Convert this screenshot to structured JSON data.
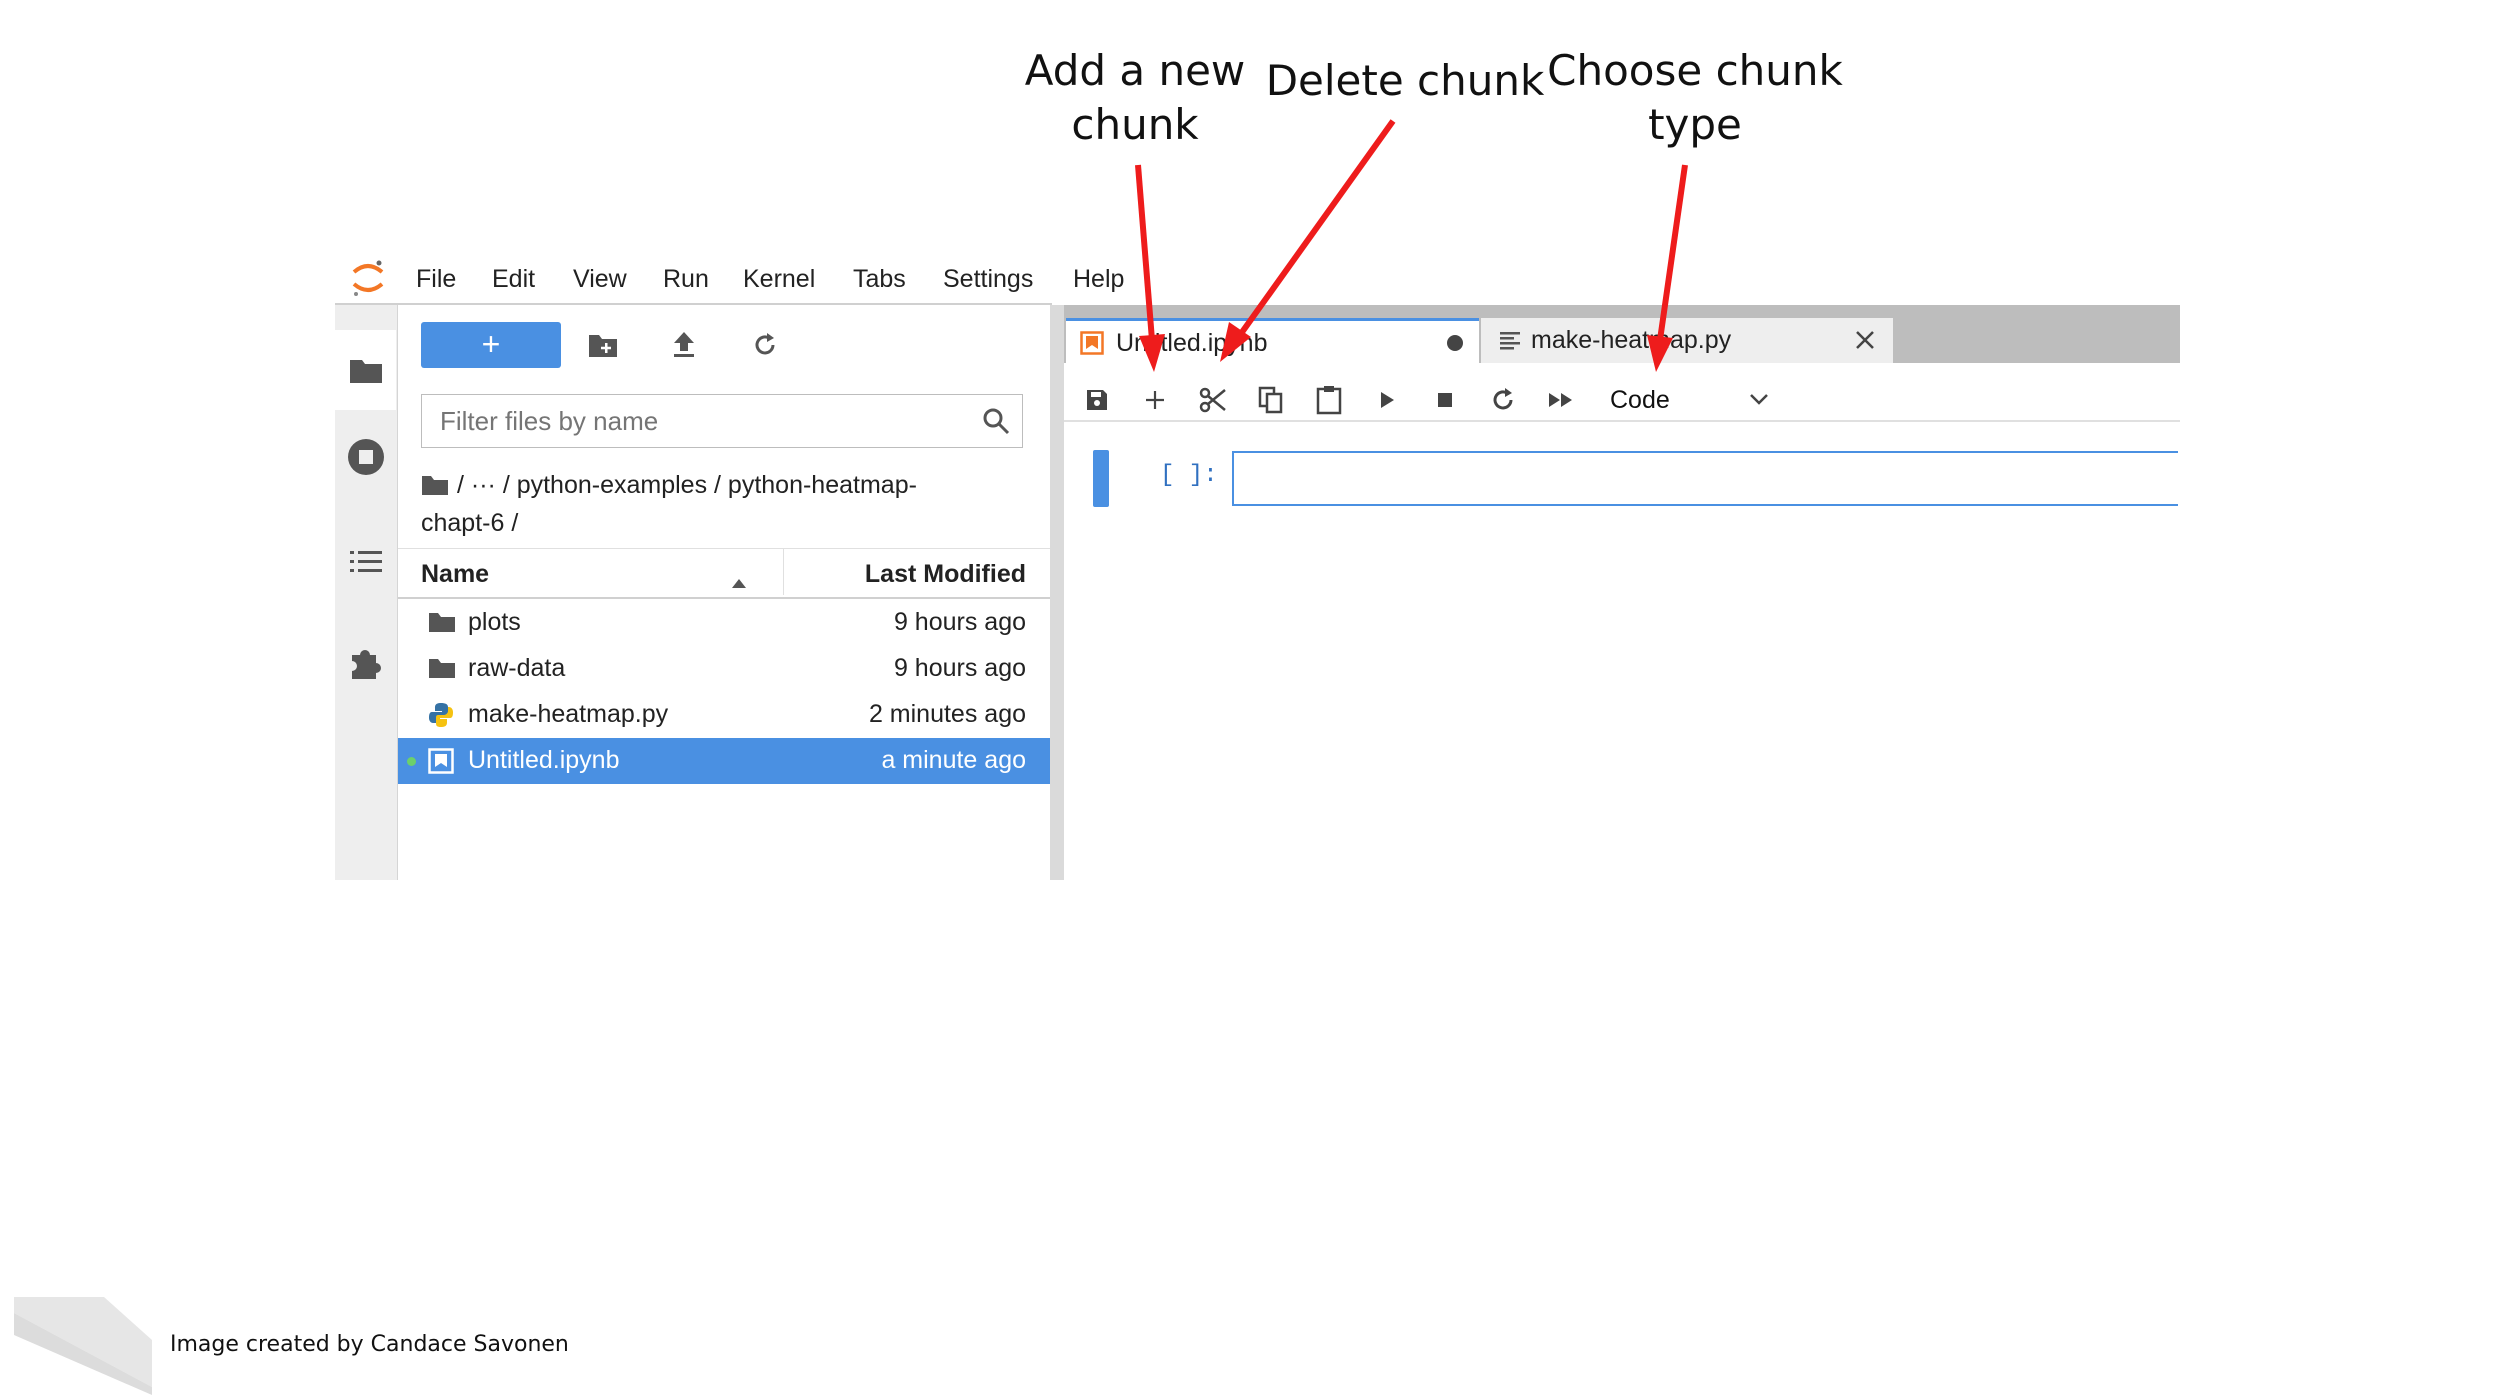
{
  "annotations": {
    "add_chunk": "Add a new\nchunk",
    "delete_chunk": "Delete chunk",
    "choose_type": "Choose chunk\ntype"
  },
  "menu": {
    "items": [
      "File",
      "Edit",
      "View",
      "Run",
      "Kernel",
      "Tabs",
      "Settings",
      "Help"
    ]
  },
  "file_browser": {
    "new_button": "+",
    "filter_placeholder": "Filter files by name",
    "breadcrumb_line1": "/   ···   / python-examples / python-heatmap-",
    "breadcrumb_line2": "chapt-6 /",
    "col_name": "Name",
    "col_modified": "Last Modified",
    "rows": [
      {
        "name": "plots",
        "modified": "9 hours ago",
        "icon": "folder-icon"
      },
      {
        "name": "raw-data",
        "modified": "9 hours ago",
        "icon": "folder-icon"
      },
      {
        "name": "make-heatmap.py",
        "modified": "2 minutes ago",
        "icon": "python-icon"
      },
      {
        "name": "Untitled.ipynb",
        "modified": "a minute ago",
        "icon": "notebook-icon",
        "selected": true
      }
    ]
  },
  "tabs": [
    {
      "label": "Untitled.ipynb",
      "active": true
    },
    {
      "label": "make-heatmap.py",
      "active": false
    }
  ],
  "toolbar": {
    "cell_type": "Code"
  },
  "cell": {
    "prompt": "[ ]:"
  },
  "credit": "Image created by Candace Savonen",
  "colors": {
    "accent": "#4a90e2",
    "selected_row": "#4a90e2",
    "arrow": "#ee1c1c"
  }
}
